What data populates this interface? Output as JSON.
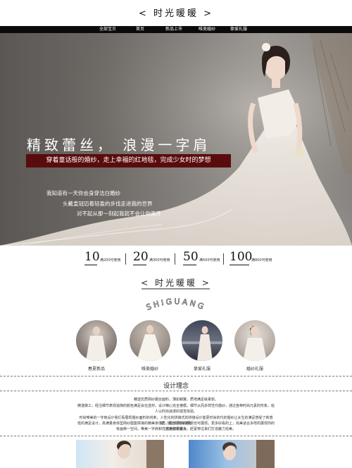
{
  "header": {
    "brand": "< 时光暖暖 >"
  },
  "nav": {
    "items": [
      "全部宝贝",
      "首页",
      "新品上市",
      "唯美婚纱",
      "挚爱礼服"
    ]
  },
  "banner": {
    "headline": "精致蕾丝， 浪漫一字肩",
    "tagline": "穿着童话般的婚纱，走上幸福的红地毯，完成少女时的梦想",
    "lines": [
      "我知道有一天你会身穿洁白婚纱",
      "头戴皇冠迈着轻盈的步伐走进我的世界",
      "对不起从那一刻起我就不会让你离开"
    ]
  },
  "coupons": [
    {
      "amount": "10",
      "condition": "满200可使用"
    },
    {
      "amount": "20",
      "condition": "满300可使用"
    },
    {
      "amount": "50",
      "condition": "满500可使用"
    },
    {
      "amount": "100",
      "condition": "满800可使用"
    }
  ],
  "section": {
    "title": "< 时光暖暖 >",
    "arc_text": "SHIGUANG"
  },
  "categories": [
    {
      "label": "春夏新品"
    },
    {
      "label": "唯美婚纱"
    },
    {
      "label": "挚爱礼服"
    },
    {
      "label": "婚纱礼服"
    }
  ],
  "design": {
    "heading": "设计理念",
    "lines": [
      "精选优质网纱蕾丝面料，薄如蝉翼，质地满足就柔软。",
      "精湛做工，经注细节表现追随的颜色满足会在选材，设计精心完全遵循，细节从而多样性代婚纱，通过各种时尚元素的形象，给人以时尚浪漫的视觉体验。",
      "时尚唯美的一字肩设计我们看展现婚纱面料的线条，人性化的拼接式的拼接设计能更时尚的代的婚纱让女生的满足感受了新感觉，使让你简单拥有",
      "低的满足设计，高满量身体型网纱图案拼接的精美亲体质，更有更多的展现也可展现，更多好看的上，完美适合多样的展现你的完美效果最大",
      "有画种一空间，唯美一字肩和性感挂脖的宴会，赶紧穿过来们打造魅力完美。"
    ]
  },
  "colors": {
    "accent": "#5a0c0c",
    "nav_bg": "#0b0b0b"
  }
}
